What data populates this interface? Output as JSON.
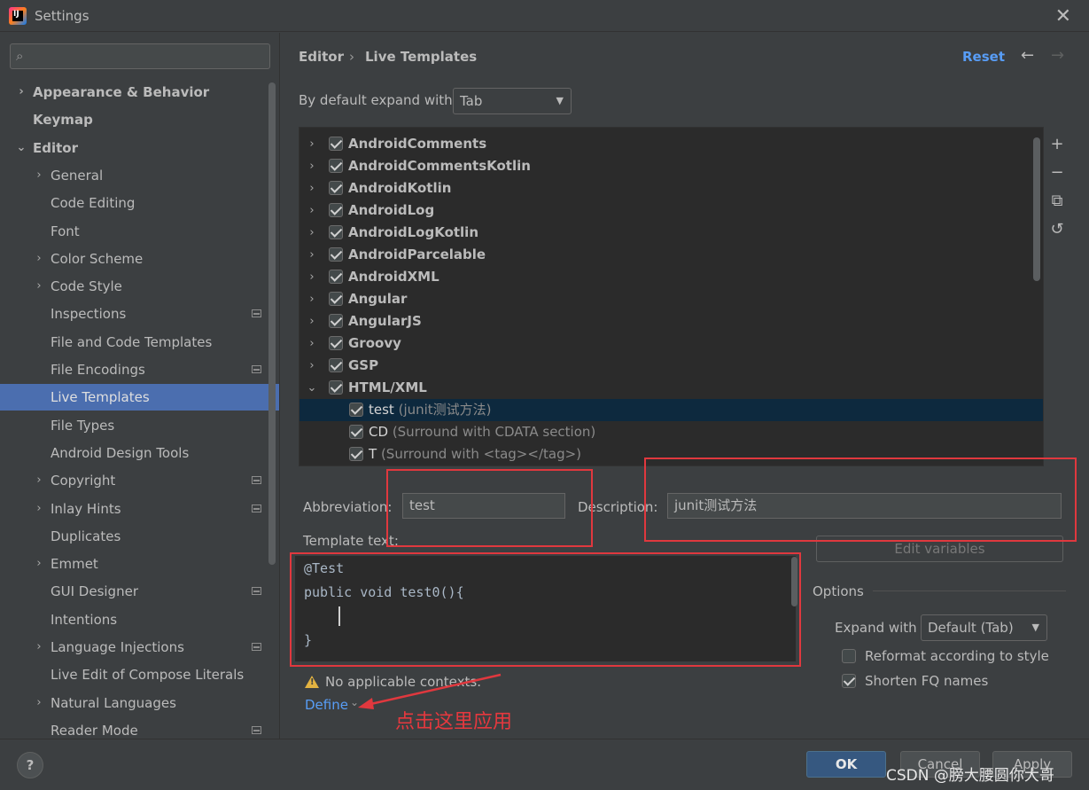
{
  "window": {
    "title": "Settings",
    "app_icon_letters": "IJ",
    "close_glyph": "✕"
  },
  "search": {
    "icon": "search-icon",
    "glyph": "⌕",
    "value": ""
  },
  "sidebar": {
    "items": [
      {
        "label": "Appearance & Behavior",
        "chevron": "›",
        "bold": true
      },
      {
        "label": "Keymap",
        "chevron": "",
        "bold": true
      },
      {
        "label": "Editor",
        "chevron": "⌄",
        "bold": true
      },
      {
        "label": "General",
        "chevron": "›"
      },
      {
        "label": "Code Editing",
        "chevron": ""
      },
      {
        "label": "Font",
        "chevron": ""
      },
      {
        "label": "Color Scheme",
        "chevron": "›"
      },
      {
        "label": "Code Style",
        "chevron": "›"
      },
      {
        "label": "Inspections",
        "chevron": ""
      },
      {
        "label": "File and Code Templates",
        "chevron": ""
      },
      {
        "label": "File Encodings",
        "chevron": ""
      },
      {
        "label": "Live Templates",
        "chevron": "",
        "selected": true
      },
      {
        "label": "File Types",
        "chevron": ""
      },
      {
        "label": "Android Design Tools",
        "chevron": ""
      },
      {
        "label": "Copyright",
        "chevron": "›"
      },
      {
        "label": "Inlay Hints",
        "chevron": "›"
      },
      {
        "label": "Duplicates",
        "chevron": ""
      },
      {
        "label": "Emmet",
        "chevron": "›"
      },
      {
        "label": "GUI Designer",
        "chevron": ""
      },
      {
        "label": "Intentions",
        "chevron": ""
      },
      {
        "label": "Language Injections",
        "chevron": "›"
      },
      {
        "label": "Live Edit of Compose Literals",
        "chevron": ""
      },
      {
        "label": "Natural Languages",
        "chevron": "›"
      },
      {
        "label": "Reader Mode",
        "chevron": ""
      }
    ]
  },
  "header": {
    "crumb_parent": "Editor",
    "crumb_sep": "›",
    "crumb_current": "Live Templates",
    "reset": "Reset",
    "back_glyph": "←",
    "forward_glyph": "→"
  },
  "expand": {
    "label": "By default expand with",
    "value": "Tab",
    "arrow": "▼"
  },
  "templates": {
    "groups": [
      {
        "name": "AndroidComments",
        "chevron": "›",
        "checked": true
      },
      {
        "name": "AndroidCommentsKotlin",
        "chevron": "›",
        "checked": true
      },
      {
        "name": "AndroidKotlin",
        "chevron": "›",
        "checked": true
      },
      {
        "name": "AndroidLog",
        "chevron": "›",
        "checked": true
      },
      {
        "name": "AndroidLogKotlin",
        "chevron": "›",
        "checked": true
      },
      {
        "name": "AndroidParcelable",
        "chevron": "›",
        "checked": true
      },
      {
        "name": "AndroidXML",
        "chevron": "›",
        "checked": true
      },
      {
        "name": "Angular",
        "chevron": "›",
        "checked": true
      },
      {
        "name": "AngularJS",
        "chevron": "›",
        "checked": true
      },
      {
        "name": "Groovy",
        "chevron": "›",
        "checked": true
      },
      {
        "name": "GSP",
        "chevron": "›",
        "checked": true
      },
      {
        "name": "HTML/XML",
        "chevron": "⌄",
        "checked": true
      }
    ],
    "children": [
      {
        "name": "test",
        "desc": "(junit测试方法)",
        "checked": true,
        "selected": true
      },
      {
        "name": "CD",
        "desc": "(Surround with CDATA section)",
        "checked": true
      },
      {
        "name": "T",
        "desc": "(Surround with <tag></tag>)",
        "checked": true
      }
    ],
    "tools": [
      {
        "name": "add-icon",
        "glyph": "+"
      },
      {
        "name": "remove-icon",
        "glyph": "−"
      },
      {
        "name": "copy-icon",
        "glyph": "⧉"
      },
      {
        "name": "restore-icon",
        "glyph": "↺"
      }
    ]
  },
  "form": {
    "abbreviation_label": "Abbreviation:",
    "abbreviation_value": "test",
    "description_label": "Description:",
    "description_value": "junit测试方法",
    "template_text_label": "Template text:",
    "edit_variables": "Edit variables",
    "code_lines": [
      "@Test",
      "public void test0(){",
      "",
      "}"
    ]
  },
  "options": {
    "title": "Options",
    "expand_label": "Expand with",
    "expand_value": "Default (Tab)",
    "reformat_label": "Reformat according to style",
    "reformat_checked": false,
    "shorten_label": "Shorten FQ names",
    "shorten_checked": true
  },
  "contexts": {
    "warning_glyph": "!",
    "warning": "No applicable contexts.",
    "define": "Define",
    "define_chevron": "⌄"
  },
  "annotation": {
    "text": "点击这里应用",
    "color": "#e6383e"
  },
  "footer": {
    "help": "?",
    "ok": "OK",
    "cancel": "Cancel",
    "apply": "Apply"
  },
  "watermark": "CSDN @膀大腰圆你大哥",
  "colors": {
    "accent": "#589df6",
    "selection": "#4b6eaf",
    "annotation_red": "#e0383e",
    "ok_button": "#365880"
  }
}
